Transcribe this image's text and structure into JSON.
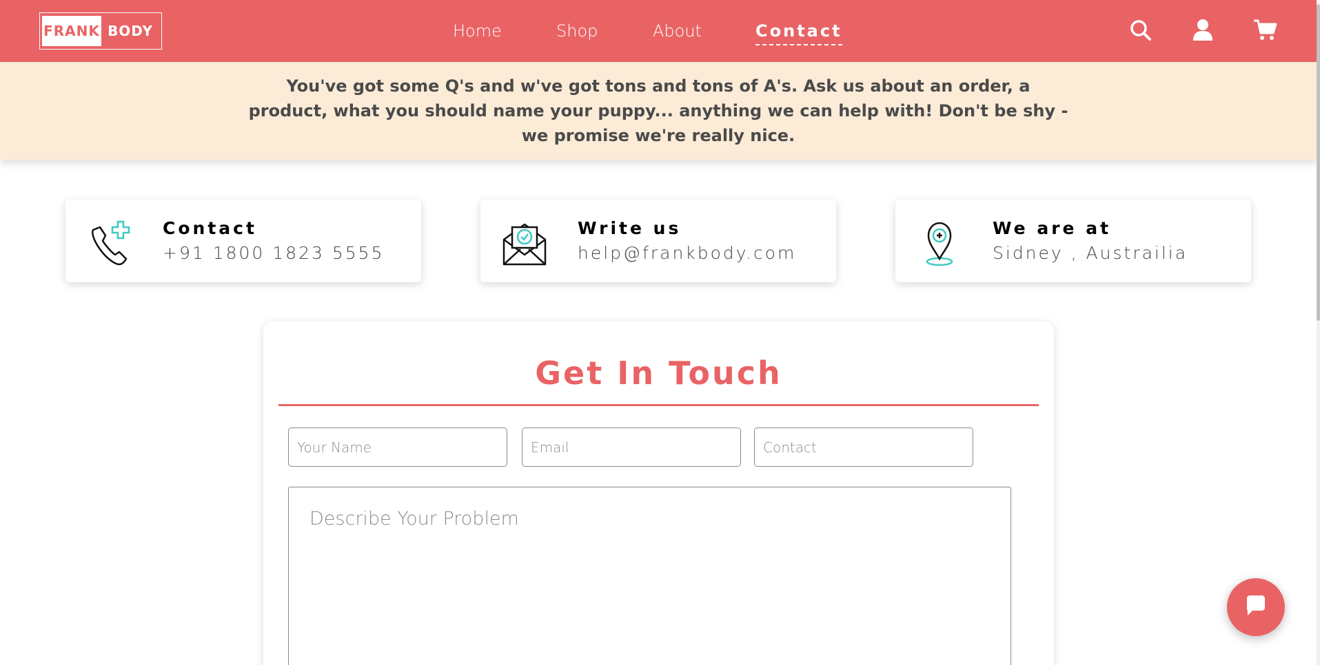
{
  "brand": {
    "logo_left": "FRANK",
    "logo_right": "BODY",
    "accent_color": "#e96365",
    "banner_color": "#fbebd7"
  },
  "nav": {
    "items": [
      {
        "label": "Home"
      },
      {
        "label": "Shop"
      },
      {
        "label": "About"
      },
      {
        "label": "Contact",
        "active": true
      }
    ],
    "icons": [
      "search-icon",
      "user-icon",
      "cart-icon"
    ]
  },
  "banner": {
    "text": "You've got some Q's and w've got tons and tons of A's. Ask us about an order, a product, what you should name your puppy... anything we can help with! Don't be shy -we promise we're really nice."
  },
  "cards": [
    {
      "title": "Contact",
      "value": "+91 1800 1823 5555",
      "icon": "phone-plus-icon"
    },
    {
      "title": "Write us",
      "value": "help@frankbody.com",
      "icon": "envelope-check-icon"
    },
    {
      "title": "We are at",
      "value": "Sidney , Austrailia",
      "icon": "map-pin-icon"
    }
  ],
  "form": {
    "title": "Get In Touch",
    "name_placeholder": "Your Name",
    "email_placeholder": "Email",
    "contact_placeholder": "Contact",
    "problem_placeholder": "Describe Your Problem"
  },
  "chat": {
    "icon": "chat-bubble-icon"
  }
}
